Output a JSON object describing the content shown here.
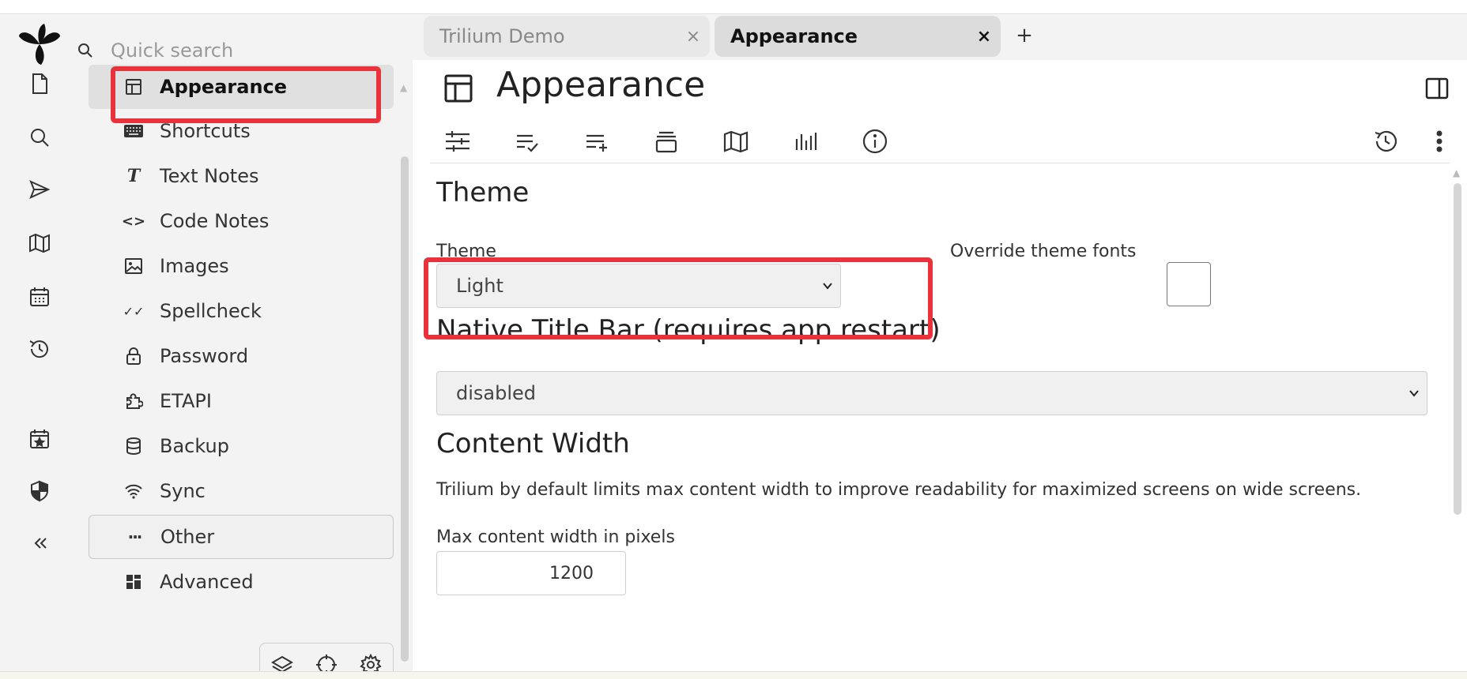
{
  "search": {
    "placeholder": "Quick search"
  },
  "tree": {
    "items": [
      {
        "label": "Appearance",
        "icon": "layout-icon",
        "active": true
      },
      {
        "label": "Shortcuts",
        "icon": "keyboard-icon"
      },
      {
        "label": "Text Notes",
        "icon": "text-icon",
        "glyph": "T"
      },
      {
        "label": "Code Notes",
        "icon": "code-icon",
        "glyph": "<>"
      },
      {
        "label": "Images",
        "icon": "image-icon"
      },
      {
        "label": "Spellcheck",
        "icon": "check-double-icon",
        "glyph": "✓✓"
      },
      {
        "label": "Password",
        "icon": "lock-icon"
      },
      {
        "label": "ETAPI",
        "icon": "puzzle-icon"
      },
      {
        "label": "Backup",
        "icon": "database-icon"
      },
      {
        "label": "Sync",
        "icon": "wifi-icon"
      },
      {
        "label": "Other",
        "icon": "dots-icon",
        "glyph": "···"
      },
      {
        "label": "Advanced",
        "icon": "dashboard-icon"
      }
    ]
  },
  "tabs": [
    {
      "label": "Trilium Demo",
      "close": "×"
    },
    {
      "label": "Appearance",
      "close": "×"
    }
  ],
  "newtab": "+",
  "note": {
    "title": "Appearance"
  },
  "content": {
    "theme_heading": "Theme",
    "theme_label": "Theme",
    "theme_value": "Light",
    "override_label": "Override theme fonts",
    "native_heading": "Native Title Bar (requires app restart)",
    "native_value": "disabled",
    "width_heading": "Content Width",
    "width_desc": "Trilium by default limits max content width to improve readability for maximized screens on wide screens.",
    "max_label": "Max content width in pixels",
    "max_value": "1200"
  },
  "colors": {
    "highlight": "#e8333c",
    "active_bg": "#e0e0e0"
  }
}
